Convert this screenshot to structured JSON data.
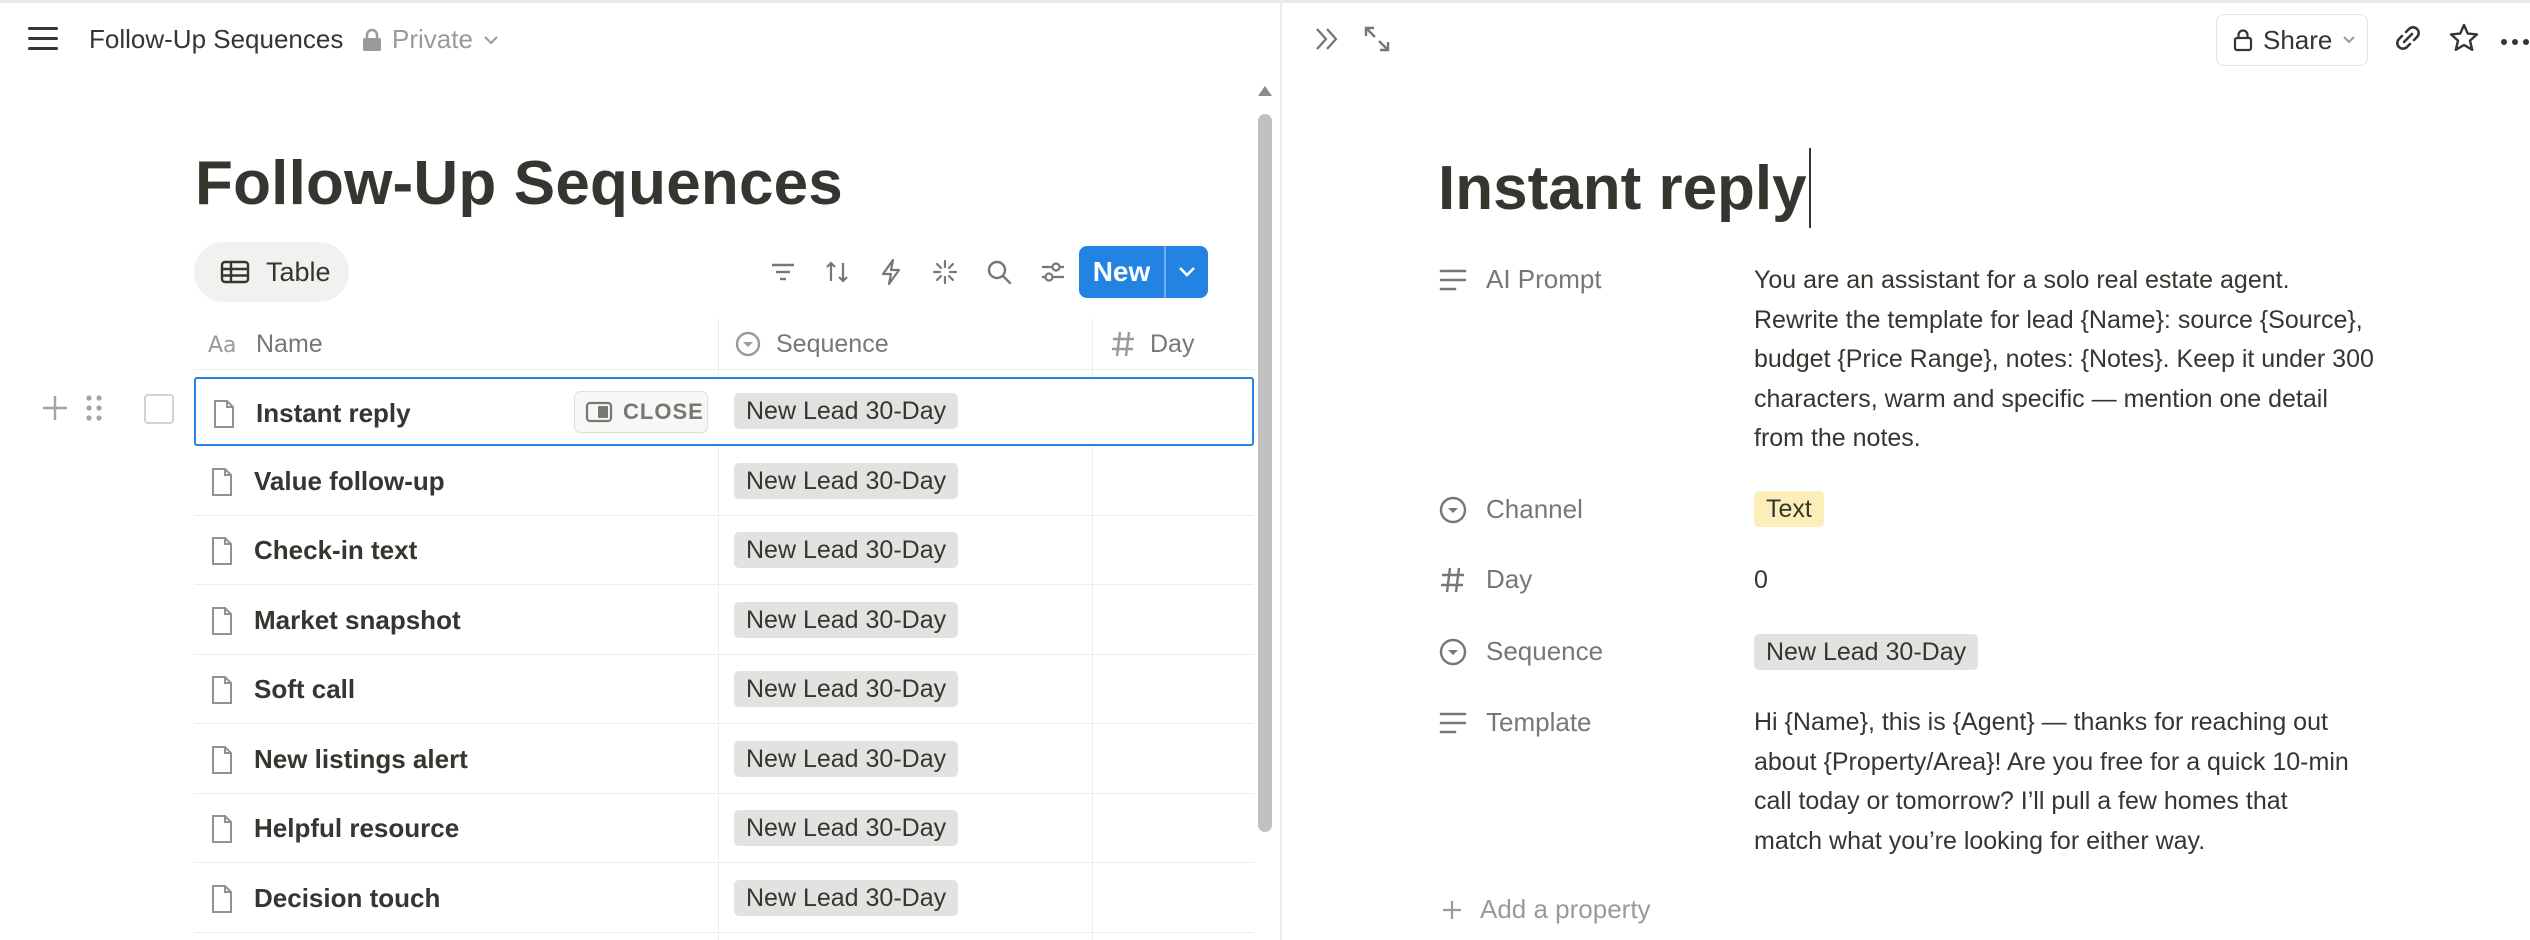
{
  "left_header": {
    "title": "Follow-Up Sequences",
    "privacy": "Private"
  },
  "database": {
    "title": "Follow-Up Sequences",
    "view_tab": "Table",
    "new_button": "New",
    "columns": {
      "name": "Name",
      "sequence": "Sequence",
      "day": "Day"
    },
    "close_label": "CLOSE",
    "rows": [
      {
        "name": "Instant reply",
        "sequence": "New Lead 30-Day"
      },
      {
        "name": "Value follow-up",
        "sequence": "New Lead 30-Day"
      },
      {
        "name": "Check-in text",
        "sequence": "New Lead 30-Day"
      },
      {
        "name": "Market snapshot",
        "sequence": "New Lead 30-Day"
      },
      {
        "name": "Soft call",
        "sequence": "New Lead 30-Day"
      },
      {
        "name": "New listings alert",
        "sequence": "New Lead 30-Day"
      },
      {
        "name": "Helpful resource",
        "sequence": "New Lead 30-Day"
      },
      {
        "name": "Decision touch",
        "sequence": "New Lead 30-Day"
      }
    ]
  },
  "peek": {
    "share_label": "Share",
    "title": "Instant reply",
    "properties": {
      "ai_prompt": {
        "label": "AI Prompt",
        "lines": [
          "You are an assistant for a solo real estate agent.",
          "Rewrite the template for lead {Name}: source {Source},",
          "budget {Price Range}, notes: {Notes}. Keep it under 300",
          "characters, warm and specific — mention one detail",
          "from the notes."
        ]
      },
      "channel": {
        "label": "Channel",
        "value": "Text",
        "color": "#fbeeb8"
      },
      "day": {
        "label": "Day",
        "value": "0"
      },
      "sequence": {
        "label": "Sequence",
        "value": "New Lead 30-Day",
        "color": "#e3e2e0"
      },
      "template": {
        "label": "Template",
        "lines": [
          "Hi {Name}, this is {Agent} — thanks for reaching out",
          "about {Property/Area}! Are you free for a quick 10-min",
          "call today or tomorrow? I’ll pull a few homes that",
          "match what you’re looking for either way."
        ]
      }
    },
    "add_property": "Add a property"
  },
  "colors": {
    "accent": "#2383e2",
    "text": "#37352f",
    "muted": "#787774"
  }
}
